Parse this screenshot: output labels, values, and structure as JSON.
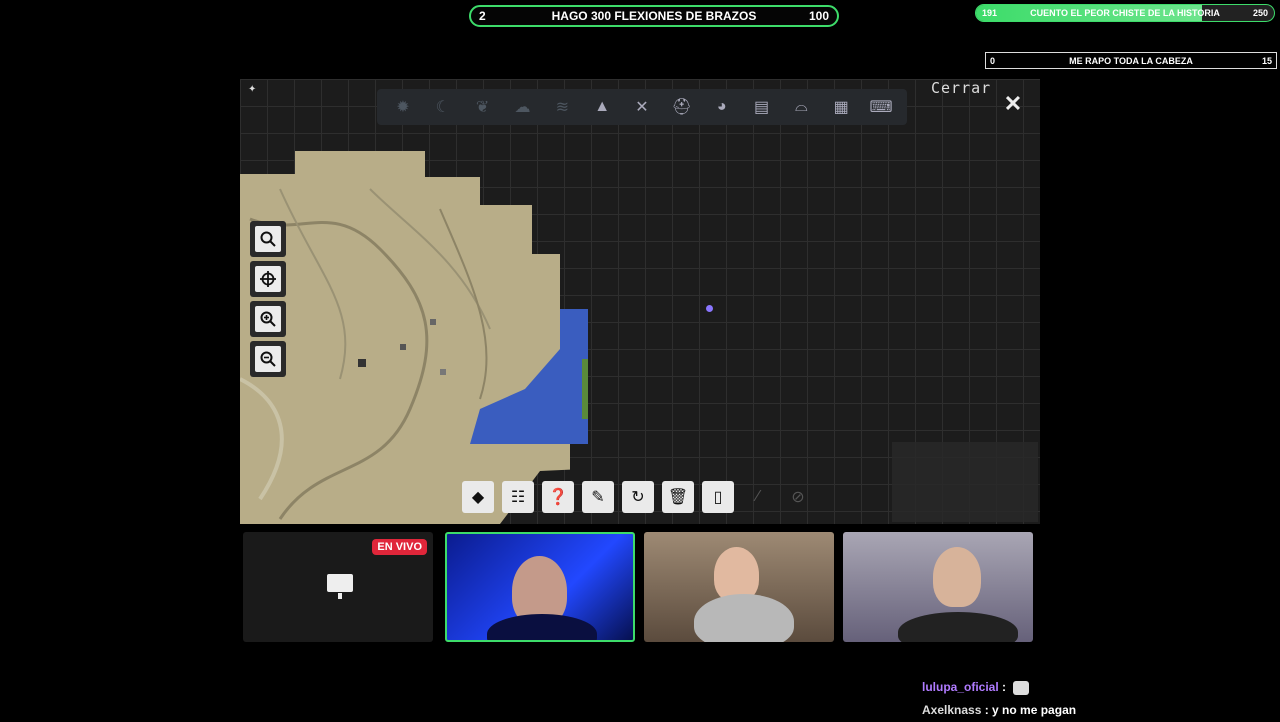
{
  "goals": {
    "main": {
      "start": "2",
      "title": "HAGO 300 FLEXIONES DE BRAZOS",
      "end": "100"
    },
    "top_right": {
      "start": "191",
      "title": "CUENTO EL PEOR CHISTE DE LA HISTORIA",
      "end": "250",
      "progress": 0.76
    },
    "small": {
      "start": "0",
      "title": "ME RAPO TODA LA CABEZA",
      "end": "15"
    }
  },
  "map": {
    "close_label": "Cerrar",
    "top_icons": [
      "sun-icon",
      "moon-icon",
      "leaf-icon",
      "cloud-icon",
      "layers-icon",
      "mountain-icon",
      "cross-icon",
      "helmet-icon",
      "creature-icon",
      "save-icon",
      "bridge-icon",
      "grid-icon",
      "keyboard-icon"
    ],
    "side_tools": [
      "search-icon",
      "crosshair-icon",
      "zoom-in-icon",
      "zoom-out-icon"
    ],
    "bottom_tools": [
      "waypoint-icon",
      "sliders-icon",
      "help-icon",
      "palette-icon",
      "refresh-icon",
      "trash-icon",
      "document-icon",
      "brush-icon",
      "disabled-icon"
    ]
  },
  "stream": {
    "live_badge": "EN VIVO"
  },
  "chat": [
    {
      "user": "lulupa_oficial",
      "message": ":"
    },
    {
      "user": "Axelknass",
      "message": ": y no me pagan"
    }
  ],
  "colors": {
    "accent": "#3ddc6a",
    "live": "#e0263a",
    "chat_user": "#b07bff"
  }
}
